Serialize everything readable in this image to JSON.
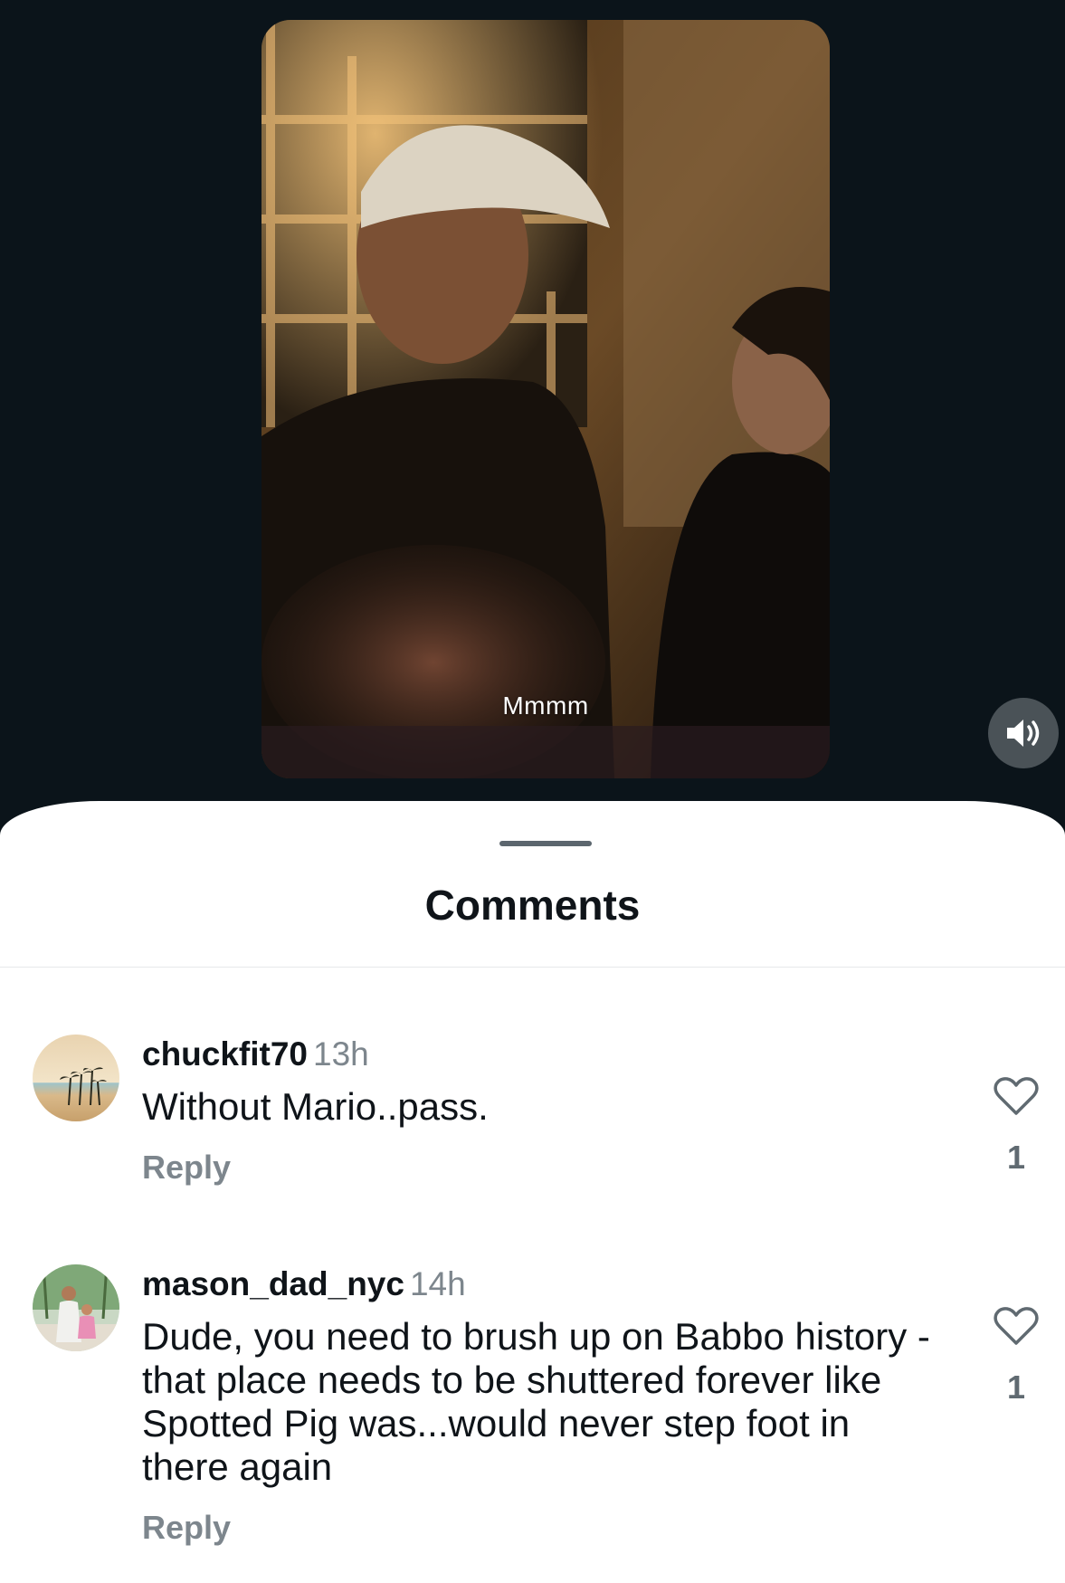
{
  "video": {
    "caption": "Mmmm",
    "sound_icon": "speaker-on-icon"
  },
  "sheet": {
    "title": "Comments"
  },
  "comments": [
    {
      "username": "chuckfit70",
      "time": "13h",
      "text": "Without Mario..pass.",
      "reply_label": "Reply",
      "like_count": "1",
      "avatar": "palm-trees-beach-avatar"
    },
    {
      "username": "mason_dad_nyc",
      "time": "14h",
      "text": "Dude, you need to brush up on Babbo history - that place needs to be shuttered forever like Spotted Pig was...would never step foot in there again",
      "reply_label": "Reply",
      "like_count": "1",
      "avatar": "family-photo-avatar"
    }
  ],
  "colors": {
    "background_dark": "#0b141a",
    "sheet": "#ffffff",
    "text": "#0f1419",
    "muted": "#7d868d"
  }
}
